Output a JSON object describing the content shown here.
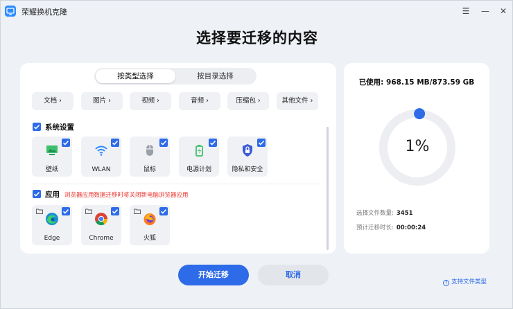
{
  "app": {
    "title": "荣耀换机克隆"
  },
  "page": {
    "title": "选择要迁移的内容"
  },
  "tabs": [
    {
      "label": "按类型选择",
      "active": true
    },
    {
      "label": "按目录选择",
      "active": false
    }
  ],
  "categories": [
    "文档 ›",
    "图片 ›",
    "视频 ›",
    "音频 ›",
    "压缩包 ›",
    "其他文件 ›"
  ],
  "sections": {
    "system": {
      "title": "系统设置",
      "checked": true,
      "items": [
        {
          "label": "壁纸",
          "icon": "wallpaper-icon",
          "checked": true
        },
        {
          "label": "WLAN",
          "icon": "wifi-icon",
          "checked": true
        },
        {
          "label": "鼠标",
          "icon": "mouse-icon",
          "checked": true
        },
        {
          "label": "电源计划",
          "icon": "battery-icon",
          "checked": true
        },
        {
          "label": "隐私和安全",
          "icon": "lock-icon",
          "checked": true
        }
      ]
    },
    "apps": {
      "title": "应用",
      "checked": true,
      "warning": "浏览器应用数据迁移时将关闭新电脑浏览器应用",
      "items": [
        {
          "label": "Edge",
          "icon": "edge-icon",
          "checked": true
        },
        {
          "label": "Chrome",
          "icon": "chrome-icon",
          "checked": true
        },
        {
          "label": "火狐",
          "icon": "firefox-icon",
          "checked": true
        }
      ]
    }
  },
  "summary": {
    "used": "已使用: 968.15 MB/873.59 GB",
    "percent": "1%",
    "progress_fraction": 0.01,
    "file_count_label": "选择文件数量:",
    "file_count": "3451",
    "time_label": "预计迁移时长:",
    "time": "00:00:24"
  },
  "actions": {
    "start": "开始迁移",
    "cancel": "取消",
    "support": "支持文件类型"
  },
  "colors": {
    "accent": "#2d6be8",
    "warning": "#e8342c"
  }
}
